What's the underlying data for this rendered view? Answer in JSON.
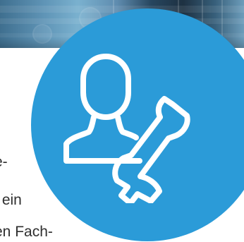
{
  "background": {
    "color": "#ffffff",
    "banner_colors": [
      "#3f6f8f",
      "#7ab1cf",
      "#27465f",
      "#6d9dbb"
    ]
  },
  "text_fragments": [
    "e-",
    "r ein",
    "en Fach-"
  ],
  "badge": {
    "color": "#2b9bd8",
    "icon_color": "#ffffff",
    "icon_name": "user-wrench-icon"
  }
}
